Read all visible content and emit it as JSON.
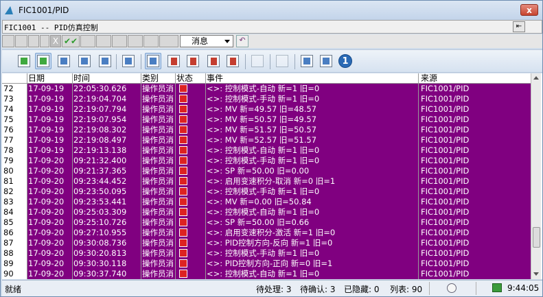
{
  "window": {
    "title": "FIC1001/PID",
    "close": "x"
  },
  "row1": {
    "title": "FIC1001 -- PID仿真控制"
  },
  "row2": {
    "x_label": "X",
    "check_label": "✔✔",
    "message_select": "消息"
  },
  "columns": [
    "日期",
    "时间",
    "类别",
    "状态",
    "事件",
    "来源"
  ],
  "rows": [
    {
      "n": "72",
      "date": "17-09-19",
      "time": "22:05:30.626",
      "cat": "操作员消",
      "event": "<>: 控制模式-自动 新=1 旧=0",
      "src": "FIC1001/PID"
    },
    {
      "n": "73",
      "date": "17-09-19",
      "time": "22:19:04.704",
      "cat": "操作员消",
      "event": "<>: 控制模式-手动 新=1 旧=0",
      "src": "FIC1001/PID"
    },
    {
      "n": "74",
      "date": "17-09-19",
      "time": "22:19:07.794",
      "cat": "操作员消",
      "event": "<>: MV 新=49.57 旧=48.57",
      "src": "FIC1001/PID"
    },
    {
      "n": "75",
      "date": "17-09-19",
      "time": "22:19:07.954",
      "cat": "操作员消",
      "event": "<>: MV 新=50.57 旧=49.57",
      "src": "FIC1001/PID"
    },
    {
      "n": "76",
      "date": "17-09-19",
      "time": "22:19:08.302",
      "cat": "操作员消",
      "event": "<>: MV 新=51.57 旧=50.57",
      "src": "FIC1001/PID"
    },
    {
      "n": "77",
      "date": "17-09-19",
      "time": "22:19:08.497",
      "cat": "操作员消",
      "event": "<>: MV 新=52.57 旧=51.57",
      "src": "FIC1001/PID"
    },
    {
      "n": "78",
      "date": "17-09-19",
      "time": "22:19:13.138",
      "cat": "操作员消",
      "event": "<>: 控制模式-自动 新=1 旧=0",
      "src": "FIC1001/PID"
    },
    {
      "n": "79",
      "date": "17-09-20",
      "time": "09:21:32.400",
      "cat": "操作员消",
      "event": "<>: 控制模式-手动 新=1 旧=0",
      "src": "FIC1001/PID"
    },
    {
      "n": "80",
      "date": "17-09-20",
      "time": "09:21:37.365",
      "cat": "操作员消",
      "event": "<>: SP 新=50.00 旧=0.00",
      "src": "FIC1001/PID"
    },
    {
      "n": "81",
      "date": "17-09-20",
      "time": "09:23:44.452",
      "cat": "操作员消",
      "event": "<>: 启用变速积分-取消 新=0 旧=1",
      "src": "FIC1001/PID"
    },
    {
      "n": "82",
      "date": "17-09-20",
      "time": "09:23:50.095",
      "cat": "操作员消",
      "event": "<>: 控制模式-手动 新=1 旧=0",
      "src": "FIC1001/PID"
    },
    {
      "n": "83",
      "date": "17-09-20",
      "time": "09:23:53.441",
      "cat": "操作员消",
      "event": "<>: MV 新=0.00 旧=50.84",
      "src": "FIC1001/PID"
    },
    {
      "n": "84",
      "date": "17-09-20",
      "time": "09:25:03.309",
      "cat": "操作员消",
      "event": "<>: 控制模式-自动 新=1 旧=0",
      "src": "FIC1001/PID"
    },
    {
      "n": "85",
      "date": "17-09-20",
      "time": "09:25:10.726",
      "cat": "操作员消",
      "event": "<>: SP 新=50.00 旧=0.66",
      "src": "FIC1001/PID"
    },
    {
      "n": "86",
      "date": "17-09-20",
      "time": "09:27:10.955",
      "cat": "操作员消",
      "event": "<>: 启用变速积分-激活 新=1 旧=0",
      "src": "FIC1001/PID"
    },
    {
      "n": "87",
      "date": "17-09-20",
      "time": "09:30:08.736",
      "cat": "操作员消",
      "event": "<>: PID控制方向-反向 新=1 旧=0",
      "src": "FIC1001/PID"
    },
    {
      "n": "88",
      "date": "17-09-20",
      "time": "09:30:20.813",
      "cat": "操作员消",
      "event": "<>: 控制模式-手动 新=1 旧=0",
      "src": "FIC1001/PID"
    },
    {
      "n": "89",
      "date": "17-09-20",
      "time": "09:30:30.118",
      "cat": "操作员消",
      "event": "<>: PID控制方向-正向 新=0 旧=1",
      "src": "FIC1001/PID"
    },
    {
      "n": "90",
      "date": "17-09-20",
      "time": "09:30:37.740",
      "cat": "操作员消",
      "event": "<>: 控制模式-自动 新=1 旧=0",
      "src": "FIC1001/PID"
    }
  ],
  "status": {
    "ready": "就绪",
    "pending": "待处理: 3",
    "unconfirmed": "待确认: 3",
    "hidden": "已隐藏: 0",
    "list": "列表: 90",
    "time": "9:44:05"
  },
  "colors": {
    "row_bg": "#800080",
    "row_text": "#ffffff",
    "flag": "#dd2222"
  }
}
